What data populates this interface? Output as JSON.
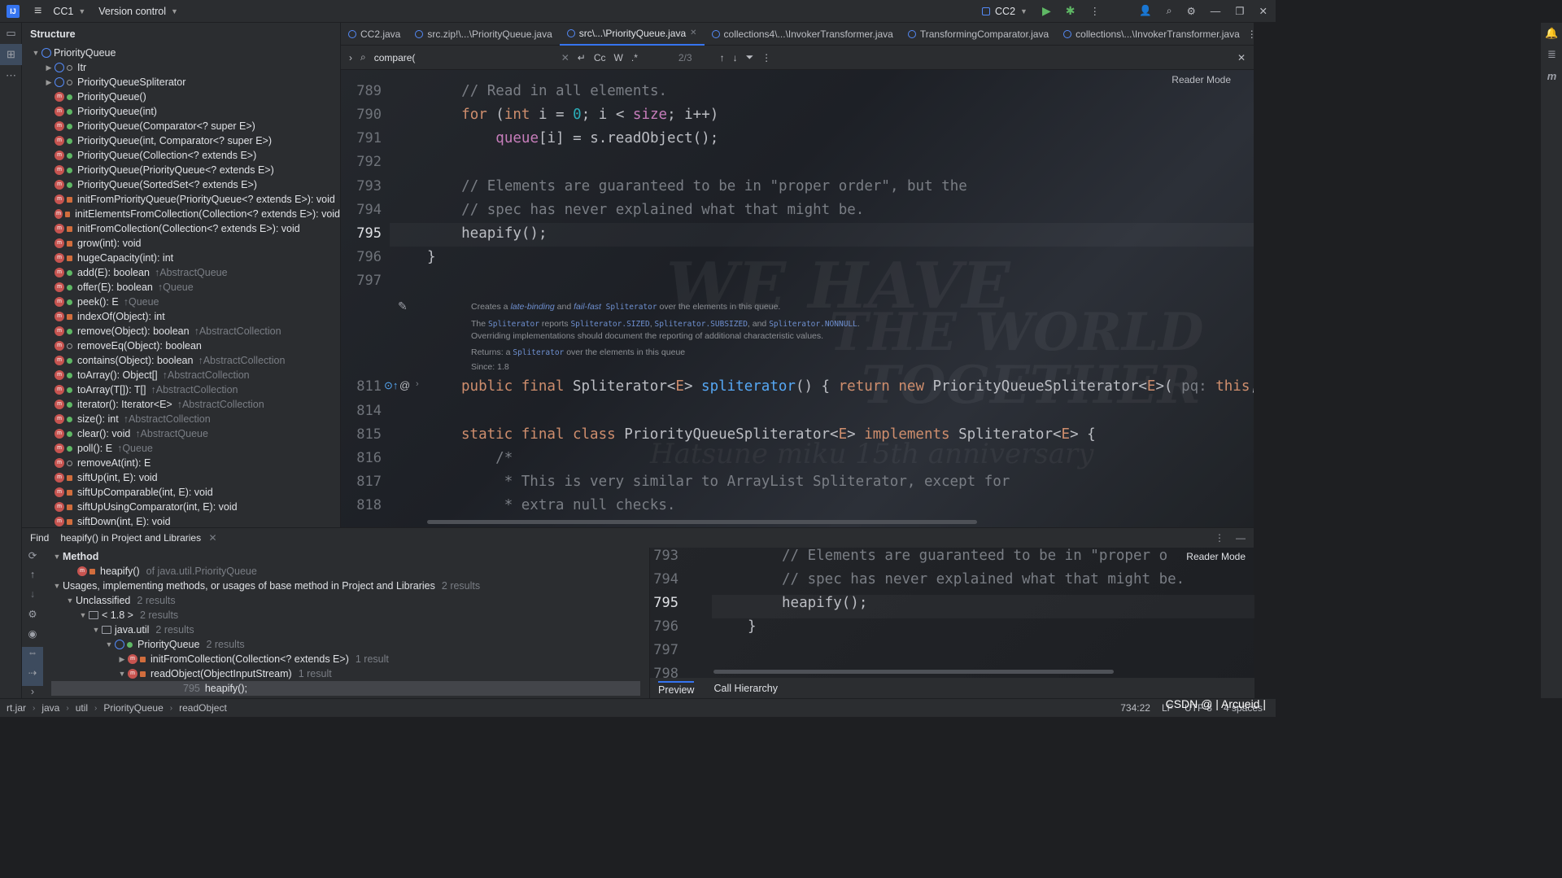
{
  "titlebar": {
    "project": "CC1",
    "vcs": "Version control",
    "run_config": "CC2"
  },
  "structure": {
    "title": "Structure",
    "root": "PriorityQueue",
    "items": [
      {
        "label": "Itr",
        "kind": "class",
        "inh": ""
      },
      {
        "label": "PriorityQueueSpliterator",
        "kind": "class",
        "inh": ""
      },
      {
        "label": "PriorityQueue()",
        "kind": "method",
        "inh": ""
      },
      {
        "label": "PriorityQueue(int)",
        "kind": "method",
        "inh": ""
      },
      {
        "label": "PriorityQueue(Comparator<? super E>)",
        "kind": "method",
        "inh": ""
      },
      {
        "label": "PriorityQueue(int, Comparator<? super E>)",
        "kind": "method",
        "inh": ""
      },
      {
        "label": "PriorityQueue(Collection<? extends E>)",
        "kind": "method",
        "inh": ""
      },
      {
        "label": "PriorityQueue(PriorityQueue<? extends E>)",
        "kind": "method",
        "inh": ""
      },
      {
        "label": "PriorityQueue(SortedSet<? extends E>)",
        "kind": "method",
        "inh": ""
      },
      {
        "label": "initFromPriorityQueue(PriorityQueue<? extends E>): void",
        "kind": "private",
        "inh": ""
      },
      {
        "label": "initElementsFromCollection(Collection<? extends E>): void",
        "kind": "private",
        "inh": ""
      },
      {
        "label": "initFromCollection(Collection<? extends E>): void",
        "kind": "private",
        "inh": ""
      },
      {
        "label": "grow(int): void",
        "kind": "private",
        "inh": ""
      },
      {
        "label": "hugeCapacity(int): int",
        "kind": "private",
        "inh": ""
      },
      {
        "label": "add(E): boolean",
        "kind": "method",
        "inh": "↑AbstractQueue"
      },
      {
        "label": "offer(E): boolean",
        "kind": "method",
        "inh": "↑Queue"
      },
      {
        "label": "peek(): E",
        "kind": "method",
        "inh": "↑Queue"
      },
      {
        "label": "indexOf(Object): int",
        "kind": "private",
        "inh": ""
      },
      {
        "label": "remove(Object): boolean",
        "kind": "method",
        "inh": "↑AbstractCollection"
      },
      {
        "label": "removeEq(Object): boolean",
        "kind": "package",
        "inh": ""
      },
      {
        "label": "contains(Object): boolean",
        "kind": "method",
        "inh": "↑AbstractCollection"
      },
      {
        "label": "toArray(): Object[]",
        "kind": "method",
        "inh": "↑AbstractCollection"
      },
      {
        "label": "toArray(T[]): T[]",
        "kind": "method",
        "inh": "↑AbstractCollection"
      },
      {
        "label": "iterator(): Iterator<E>",
        "kind": "method",
        "inh": "↑AbstractCollection"
      },
      {
        "label": "size(): int",
        "kind": "method",
        "inh": "↑AbstractCollection"
      },
      {
        "label": "clear(): void",
        "kind": "method",
        "inh": "↑AbstractQueue"
      },
      {
        "label": "poll(): E",
        "kind": "method",
        "inh": "↑Queue"
      },
      {
        "label": "removeAt(int): E",
        "kind": "package",
        "inh": ""
      },
      {
        "label": "siftUp(int, E): void",
        "kind": "private",
        "inh": ""
      },
      {
        "label": "siftUpComparable(int, E): void",
        "kind": "private",
        "inh": ""
      },
      {
        "label": "siftUpUsingComparator(int, E): void",
        "kind": "private",
        "inh": ""
      },
      {
        "label": "siftDown(int, E): void",
        "kind": "private",
        "inh": ""
      }
    ]
  },
  "tabs": [
    {
      "label": "CC2.java",
      "active": false,
      "underline": true
    },
    {
      "label": "src.zip!\\...\\PriorityQueue.java",
      "active": false,
      "underline": false
    },
    {
      "label": "src\\...\\PriorityQueue.java",
      "active": true,
      "underline": false
    },
    {
      "label": "collections4\\...\\InvokerTransformer.java",
      "active": false,
      "underline": false
    },
    {
      "label": "TransformingComparator.java",
      "active": false,
      "underline": false
    },
    {
      "label": "collections\\...\\InvokerTransformer.java",
      "active": false,
      "underline": false
    }
  ],
  "findbar": {
    "query": "compare(",
    "match_count": "2/3",
    "opt_case": "Cc",
    "opt_word": "W",
    "opt_regex": ".*"
  },
  "editor": {
    "reader_mode": "Reader Mode",
    "watermark1": "WE HAVE",
    "watermark2": "THE WORLD",
    "watermark3": "TOGETHER",
    "watermark4": "Hatsune miku 15th anniversary",
    "line_numbers": [
      "789",
      "790",
      "791",
      "792",
      "793",
      "794",
      "795",
      "796",
      "797",
      "811",
      "814",
      "815",
      "816",
      "817",
      "818"
    ],
    "doc": {
      "l1a": "Creates a ",
      "l1b": "late-binding",
      "l1c": " and ",
      "l1d": "fail-fast",
      "l1e": " Spliterator",
      "l1f": " over the elements in this queue.",
      "l2a": "The ",
      "l2b": "Spliterator",
      "l2c": " reports ",
      "l2d": "Spliterator.SIZED",
      "l2e": ", ",
      "l2f": "Spliterator.SUBSIZED",
      "l2g": ", and ",
      "l2h": "Spliterator.NONNULL",
      "l2i": ".",
      "l3": "Overriding implementations should document the reporting of additional characteristic values.",
      "l4a": "Returns: a ",
      "l4b": "Spliterator",
      "l4c": " over the elements in this queue",
      "l5": "Since:    1.8"
    }
  },
  "find": {
    "title": "Find",
    "tab": "heapify() in Project and Libraries",
    "method_hdr": "Method",
    "method_item": "heapify()",
    "method_of": "of java.util.PriorityQueue",
    "usages_hdr": "Usages, implementing methods, or usages of base method in Project and Libraries",
    "usages_cnt": "2 results",
    "unclassified": "Unclassified",
    "unclassified_cnt": "2 results",
    "jdk": "< 1.8 >",
    "jdk_cnt": "2 results",
    "pkg": "java.util",
    "pkg_cnt": "2 results",
    "cls": "PriorityQueue",
    "cls_cnt": "2 results",
    "m1": "initFromCollection(Collection<? extends E>)",
    "m1_cnt": "1 result",
    "m2": "readObject(ObjectInputStream)",
    "m2_cnt": "1 result",
    "hit_line": "795",
    "hit_text": "heapify();"
  },
  "preview": {
    "reader_mode": "Reader Mode",
    "line_numbers": [
      "793",
      "794",
      "795",
      "796",
      "797",
      "798"
    ],
    "code1": "// Elements are guaranteed to be in \"proper o",
    "code2": "// spec has never explained what that might be.",
    "code3": "heapify();",
    "code4": "}",
    "tab_preview": "Preview",
    "tab_hierarchy": "Call Hierarchy"
  },
  "statusbar": {
    "crumbs": [
      "rt.jar",
      "java",
      "util",
      "PriorityQueue",
      "readObject"
    ],
    "position": "734:22",
    "line_sep": "LF",
    "encoding": "UTF-8",
    "indent": "4 spaces",
    "watermark": "CSDN @ | Arcueid |"
  }
}
